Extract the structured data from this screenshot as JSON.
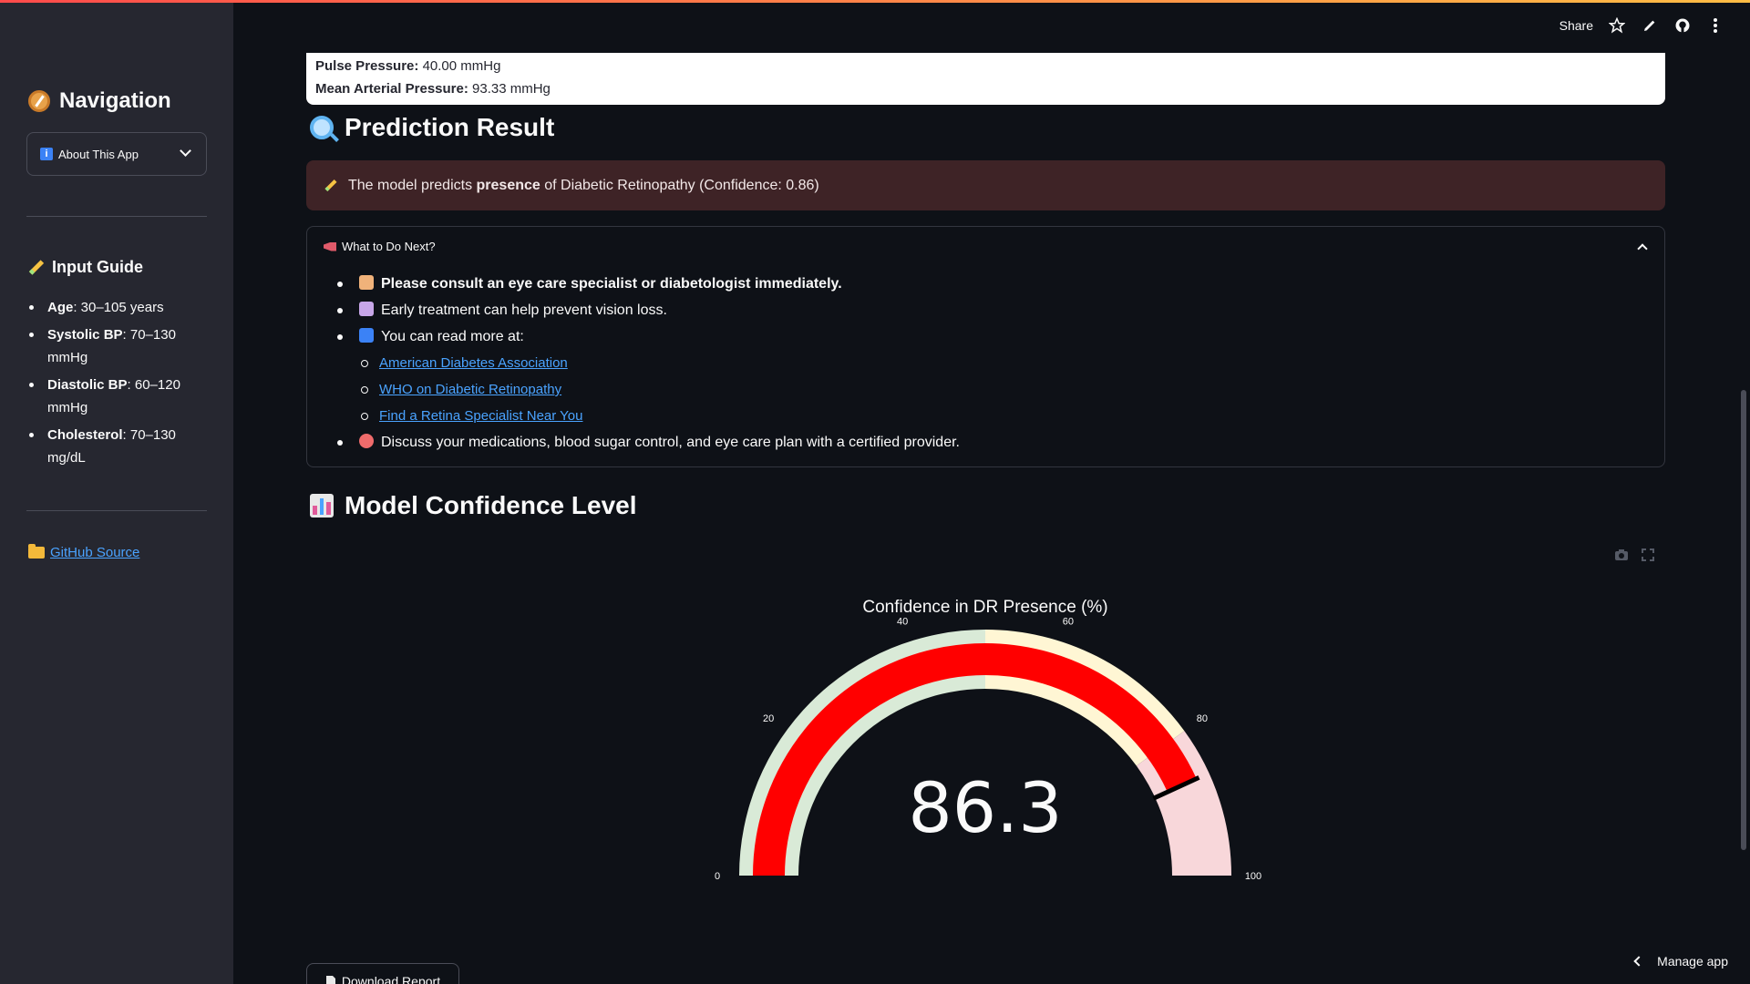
{
  "header": {
    "share_label": "Share"
  },
  "sidebar": {
    "nav_title": "Navigation",
    "select_value": "About This App",
    "guide_title": "Input Guide",
    "guide_items": [
      {
        "label": "Age",
        "value": ": 30–105 years"
      },
      {
        "label": "Systolic BP",
        "value": ": 70–130 mmHg"
      },
      {
        "label": "Diastolic BP",
        "value": ": 60–120 mmHg"
      },
      {
        "label": "Cholesterol",
        "value": ": 70–130 mg/dL"
      }
    ],
    "github_label": "GitHub Source"
  },
  "metrics": {
    "pulse_label": "Pulse Pressure:",
    "pulse_value": "40.00 mmHg",
    "map_label": "Mean Arterial Pressure:",
    "map_value": "93.33 mmHg"
  },
  "prediction": {
    "title": "Prediction Result",
    "alert_pre": "The model predicts ",
    "alert_bold": "presence",
    "alert_post": " of Diabetic Retinopathy (Confidence: 0.86)"
  },
  "next_steps": {
    "title": "What to Do Next?",
    "item1": "Please consult an eye care specialist or diabetologist immediately.",
    "item2": "Early treatment can help prevent vision loss.",
    "item3": "You can read more at:",
    "links": [
      "American Diabetes Association",
      "WHO on Diabetic Retinopathy",
      "Find a Retina Specialist Near You"
    ],
    "item4": "Discuss your medications, blood sugar control, and eye care plan with a certified provider."
  },
  "confidence": {
    "title": "Model Confidence Level"
  },
  "chart_data": {
    "type": "gauge",
    "title": "Confidence in DR Presence (%)",
    "value": 86.3,
    "value_label": "86.3",
    "range": [
      0,
      100
    ],
    "ticks": [
      "0",
      "20",
      "40",
      "60",
      "80",
      "100"
    ],
    "steps": [
      {
        "range": [
          0,
          50
        ],
        "color": "#d9ead7"
      },
      {
        "range": [
          50,
          80
        ],
        "color": "#fff6d4"
      },
      {
        "range": [
          80,
          100
        ],
        "color": "#f8d7da"
      }
    ],
    "bar_color": "#ff0000",
    "threshold_color": "#000000"
  },
  "actions": {
    "download_label": "Download Report",
    "manage_label": "Manage app"
  }
}
